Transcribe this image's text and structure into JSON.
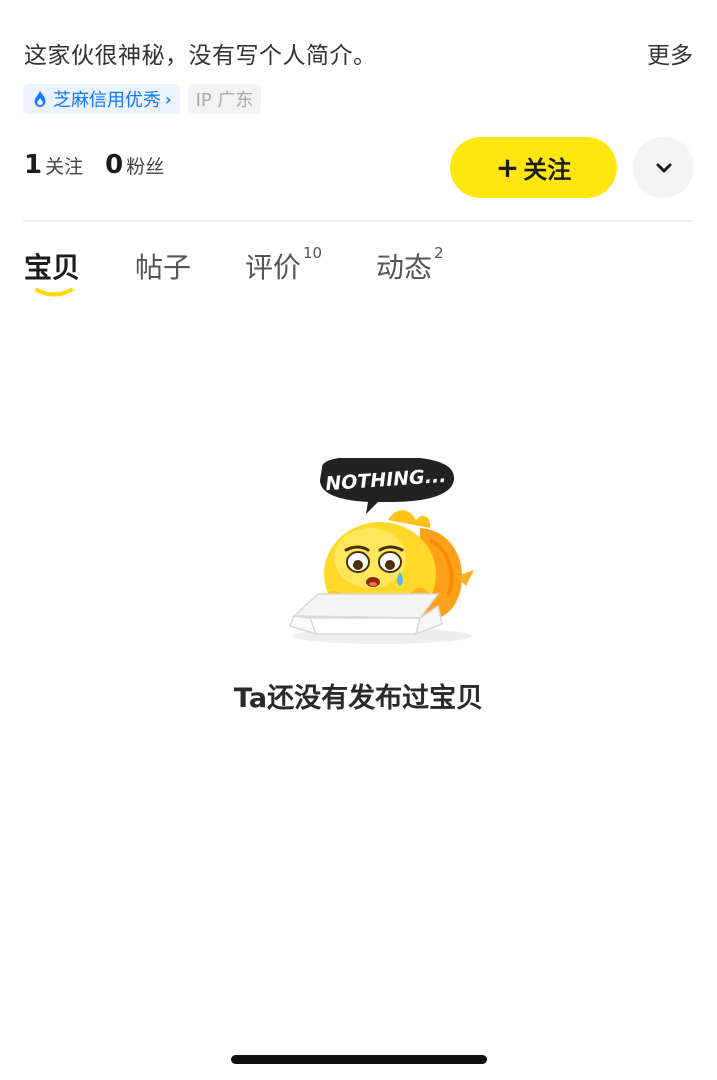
{
  "profile": {
    "bio": "这家伙很神秘，没有写个人简介。",
    "more_label": "更多",
    "credit_badge": "芝麻信用优秀",
    "ip_badge": "IP 广东",
    "following_count": "1",
    "following_label": "关注",
    "followers_count": "0",
    "followers_label": "粉丝"
  },
  "actions": {
    "follow_label": "关注",
    "follow_plus": "+"
  },
  "tabs": [
    {
      "label": "宝贝",
      "count": ""
    },
    {
      "label": "帖子",
      "count": ""
    },
    {
      "label": "评价",
      "count": "10"
    },
    {
      "label": "动态",
      "count": "2"
    }
  ],
  "empty_state": {
    "sign_text": "NOTHING...",
    "message": "Ta还没有发布过宝贝"
  },
  "colors": {
    "accent_yellow": "#ffe60f",
    "credit_blue": "#1677ff"
  }
}
